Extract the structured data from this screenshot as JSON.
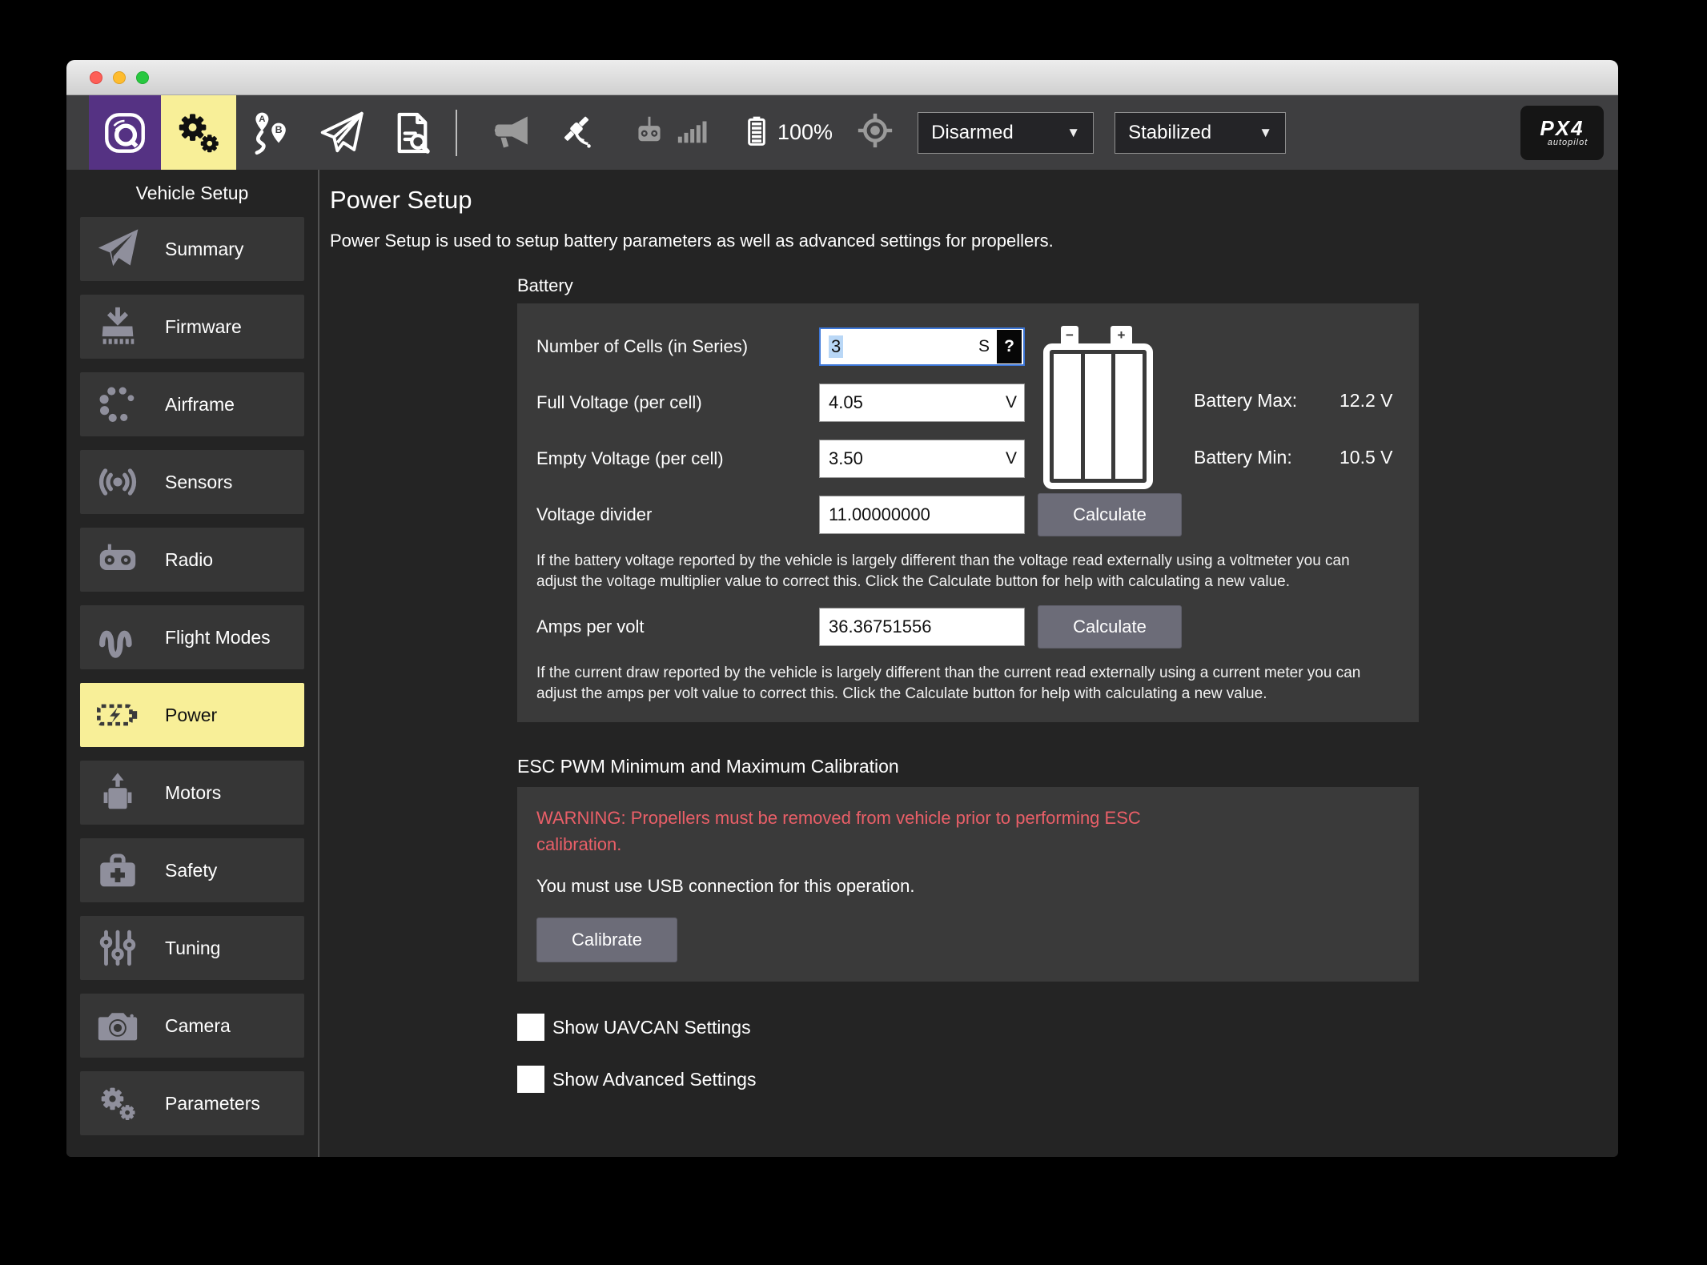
{
  "colors": {
    "accent_yellow": "#f8ef98",
    "brand_purple": "#553283",
    "warning_red": "#ea5f68",
    "focus_blue": "#3d77d8",
    "panel_gray": "#3a3a3a"
  },
  "toolbar": {
    "battery_pct": "100%",
    "armed_state": "Disarmed",
    "flight_mode": "Stabilized",
    "logo_line1": "PX4",
    "logo_line2": "autopilot"
  },
  "sidebar": {
    "title": "Vehicle Setup",
    "items": [
      {
        "label": "Summary",
        "icon": "paper-plane",
        "active": false
      },
      {
        "label": "Firmware",
        "icon": "firmware",
        "active": false
      },
      {
        "label": "Airframe",
        "icon": "airframe",
        "active": false
      },
      {
        "label": "Sensors",
        "icon": "sensors",
        "active": false
      },
      {
        "label": "Radio",
        "icon": "radio",
        "active": false
      },
      {
        "label": "Flight Modes",
        "icon": "flight-modes",
        "active": false
      },
      {
        "label": "Power",
        "icon": "power",
        "active": true
      },
      {
        "label": "Motors",
        "icon": "motors",
        "active": false
      },
      {
        "label": "Safety",
        "icon": "safety",
        "active": false
      },
      {
        "label": "Tuning",
        "icon": "tuning",
        "active": false
      },
      {
        "label": "Camera",
        "icon": "camera",
        "active": false
      },
      {
        "label": "Parameters",
        "icon": "parameters",
        "active": false
      }
    ]
  },
  "main": {
    "title": "Power Setup",
    "description": "Power Setup is used to setup battery parameters as well as advanced settings for propellers.",
    "battery": {
      "section_label": "Battery",
      "cells_label": "Number of Cells (in Series)",
      "cells_value": "3",
      "cells_unit": "S",
      "cells_help_glyph": "?",
      "full_voltage_label": "Full Voltage (per cell)",
      "full_voltage_value": "4.05",
      "full_voltage_unit": "V",
      "empty_voltage_label": "Empty Voltage (per cell)",
      "empty_voltage_value": "3.50",
      "empty_voltage_unit": "V",
      "battery_max_label": "Battery Max:",
      "battery_max_value": "12.2 V",
      "battery_min_label": "Battery Min:",
      "battery_min_value": "10.5 V",
      "voltage_divider_label": "Voltage divider",
      "voltage_divider_value": "11.00000000",
      "voltage_divider_button": "Calculate",
      "voltage_divider_help": "If the battery voltage reported by the vehicle is largely different than the voltage read externally using a voltmeter you can adjust the voltage multiplier value to correct this. Click the Calculate button for help with calculating a new value.",
      "amps_per_volt_label": "Amps per volt",
      "amps_per_volt_value": "36.36751556",
      "amps_per_volt_button": "Calculate",
      "amps_per_volt_help": "If the current draw reported by the vehicle is largely different than the current read externally using a current meter you can adjust the amps per volt value to correct this. Click the Calculate button for help with calculating a new value."
    },
    "esc": {
      "title": "ESC PWM Minimum and Maximum Calibration",
      "warning": "WARNING: Propellers must be removed from vehicle prior to performing ESC calibration.",
      "usb_note": "You must use USB connection for this operation.",
      "calibrate_button": "Calibrate"
    },
    "toggles": [
      {
        "label": "Show UAVCAN Settings",
        "checked": false
      },
      {
        "label": "Show Advanced Settings",
        "checked": false
      }
    ]
  }
}
